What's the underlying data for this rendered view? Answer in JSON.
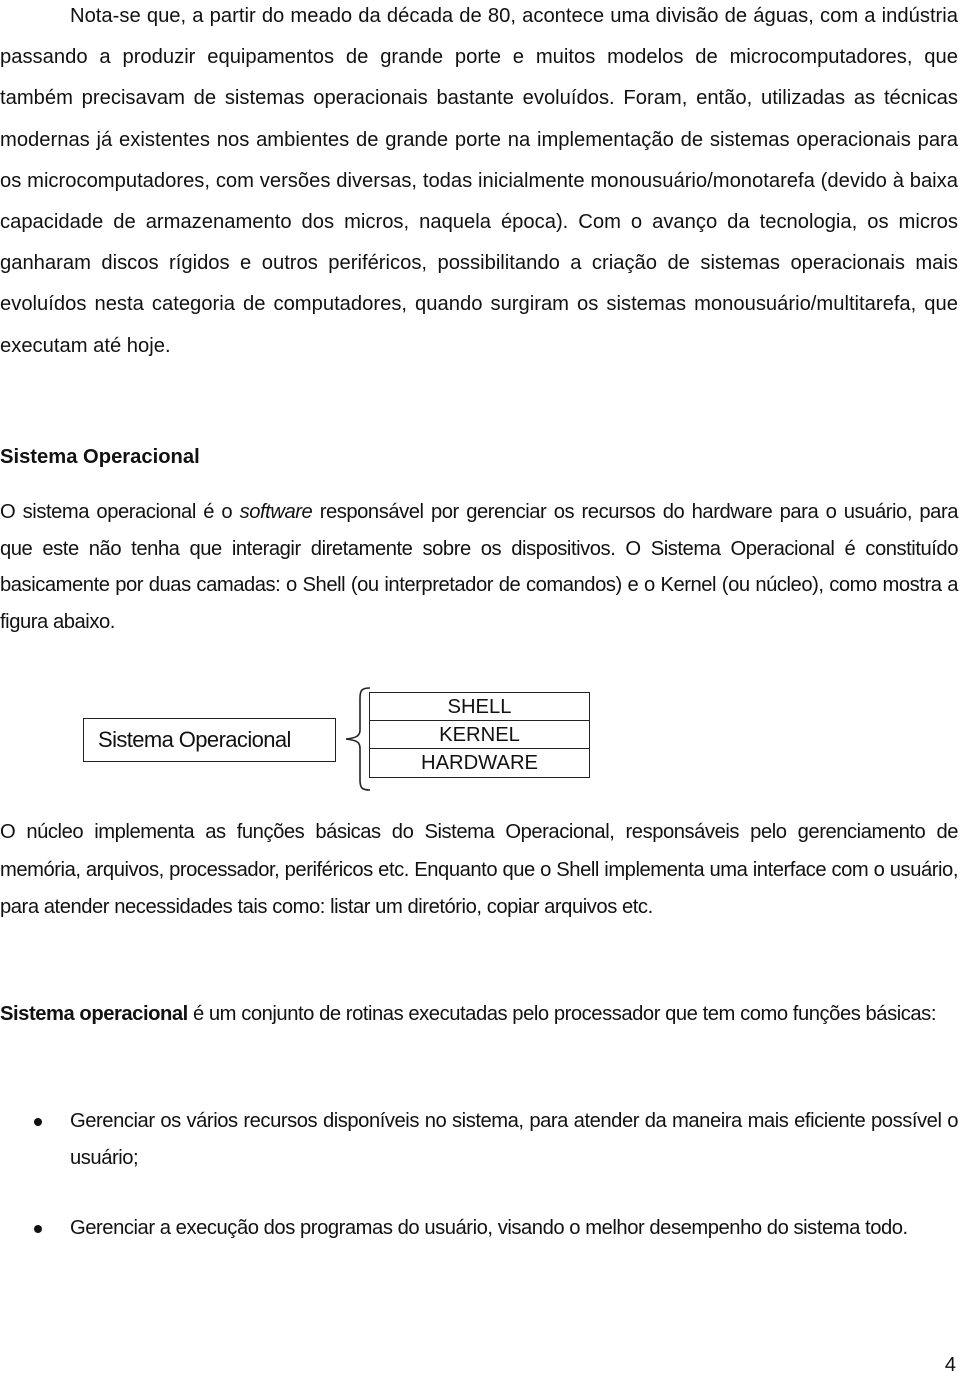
{
  "document": {
    "paragraph_1": "Nota-se que, a partir do meado da década de 80, acontece uma divisão de águas, com a indústria passando a produzir equipamentos de grande porte e muitos modelos de microcomputadores, que também precisavam de sistemas operacionais bastante evoluídos. Foram, então, utilizadas as técnicas modernas já existentes nos ambientes de grande porte na implementação de sistemas operacionais para os microcomputadores, com versões diversas, todas inicialmente monousuário/monotarefa (devido à baixa capacidade de armazenamento dos micros, naquela época). Com o avanço da tecnologia, os micros ganharam discos rígidos e outros periféricos, possibilitando a criação de sistemas operacionais mais evoluídos nesta categoria de computadores, quando surgiram os sistemas monousuário/multitarefa, que executam até hoje.",
    "section_heading": "Sistema Operacional",
    "paragraph_2": {
      "before_italic": "O sistema operacional é o ",
      "italic": "software",
      "after_italic": " responsável por gerenciar os recursos do hardware para o usuário, para que este não tenha que interagir diretamente sobre os dispositivos.  O Sistema Operacional é constituído basicamente por duas camadas: o  Shell  (ou interpretador de comandos) e o Kernel (ou núcleo), como mostra a figura abaixo."
    },
    "diagram": {
      "root_label": "Sistema Operacional",
      "layers": [
        "SHELL",
        "KERNEL",
        "HARDWARE"
      ]
    },
    "paragraph_3": "O núcleo implementa  as  funções  básicas  do  Sistema Operacional,  responsáveis  pelo gerenciamento de memória,  arquivos,  processador,  periféricos  etc.  Enquanto  que  o Shell implementa uma interface com o usuário, para atender necessidades tais como: listar um diretório, copiar arquivos etc.",
    "paragraph_4": {
      "bold": "Sistema operacional",
      "rest": " é um conjunto de rotinas executadas pelo processador que tem como funções básicas:"
    },
    "bullets": [
      "Gerenciar os vários recursos disponíveis no sistema, para atender da maneira  mais eficiente possível o usuário;",
      "Gerenciar a execução dos programas do usuário, visando o melhor desempenho do sistema todo."
    ],
    "page_number": "4"
  }
}
